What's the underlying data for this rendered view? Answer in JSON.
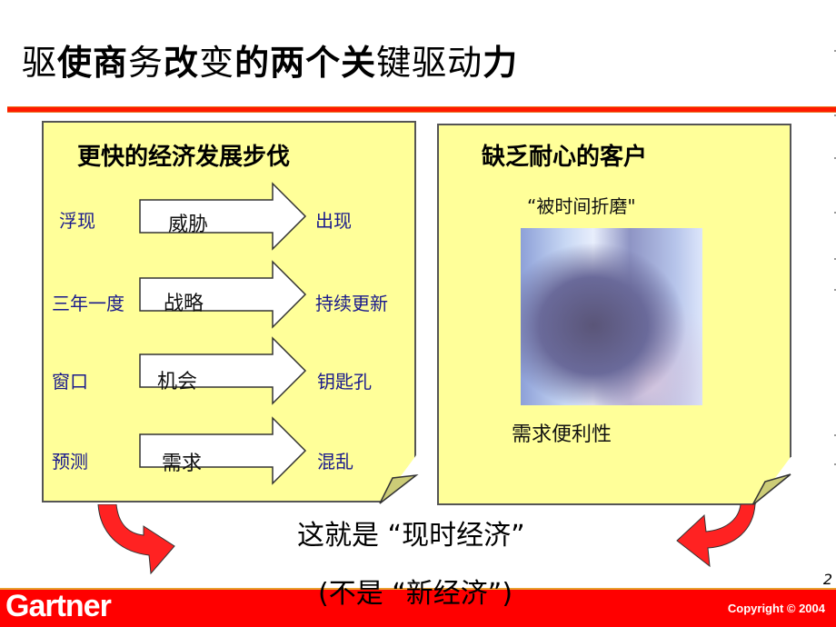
{
  "slide": {
    "title": {
      "parts": [
        {
          "text": "驱",
          "bold": false
        },
        {
          "text": "使商",
          "bold": true
        },
        {
          "text": "务",
          "bold": false
        },
        {
          "text": "改",
          "bold": true
        },
        {
          "text": "变",
          "bold": false
        },
        {
          "text": "的两个关",
          "bold": true
        },
        {
          "text": "键驱动",
          "bold": false
        },
        {
          "text": "力",
          "bold": true
        }
      ]
    },
    "left_panel": {
      "heading": "更快的经济发展步伐",
      "rows": [
        {
          "from": "浮现",
          "arrow": "威胁",
          "to": "出现"
        },
        {
          "from": "三年一度",
          "arrow": "战略",
          "to": "持续更新"
        },
        {
          "from": "窗口",
          "arrow": "机会",
          "to": "钥匙孔"
        },
        {
          "from": "预测",
          "arrow": "需求",
          "to": "混乱"
        }
      ]
    },
    "right_panel": {
      "heading": "缺乏耐心的客户",
      "quote": "“被时间折磨\"",
      "photo": "running-businessman-photo",
      "caption": "需求便利性"
    },
    "conclusion": {
      "line1": "这就是 “现时经济”",
      "line2": "(不是 “新经济”)"
    },
    "page_number": "2",
    "footer": {
      "logo": "Gartner",
      "copyright": "Copyright © 2004"
    },
    "colors": {
      "note_fill": "#ffff99",
      "accent_red": "#ff0000",
      "label_blue": "#1a1a8c"
    }
  }
}
